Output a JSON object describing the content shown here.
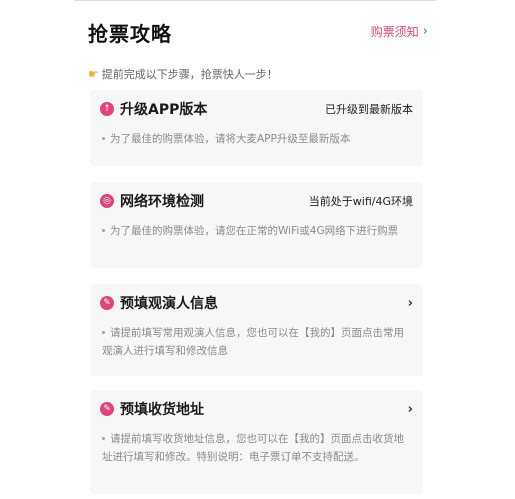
{
  "header": {
    "title": "抢票攻略",
    "notice_link": "购票须知"
  },
  "hint": {
    "text": "提前完成以下步骤，抢票快人一步！",
    "icon": "pointing-hand-icon"
  },
  "steps": [
    {
      "title": "升级APP版本",
      "status": "已升级到最新版本",
      "description": "为了最佳的购票体验，请将大麦APP升级至最新版本",
      "icon": "arrow-up-icon"
    },
    {
      "title": "网络环境检测",
      "status": "当前处于wifi/4G环境",
      "description": "为了最佳的购票体验，请您在正常的WiFi或4G网络下进行购票",
      "icon": "network-icon"
    },
    {
      "title": "预填观演人信息",
      "status": "",
      "description": "请提前填写常用观演人信息，您也可以在【我的】页面点击常用观演人进行填写和修改信息",
      "icon": "edit-icon"
    },
    {
      "title": "预填收货地址",
      "status": "",
      "description": "请提前填写收货地址信息，您也可以在【我的】页面点击收货地址进行填写和修改。特别说明：电子票订单不支持配送。",
      "icon": "edit-icon"
    }
  ],
  "colors": {
    "accent": "#e0447a",
    "card_bg": "#f7f7f7",
    "hint_icon": "#f2b428"
  }
}
